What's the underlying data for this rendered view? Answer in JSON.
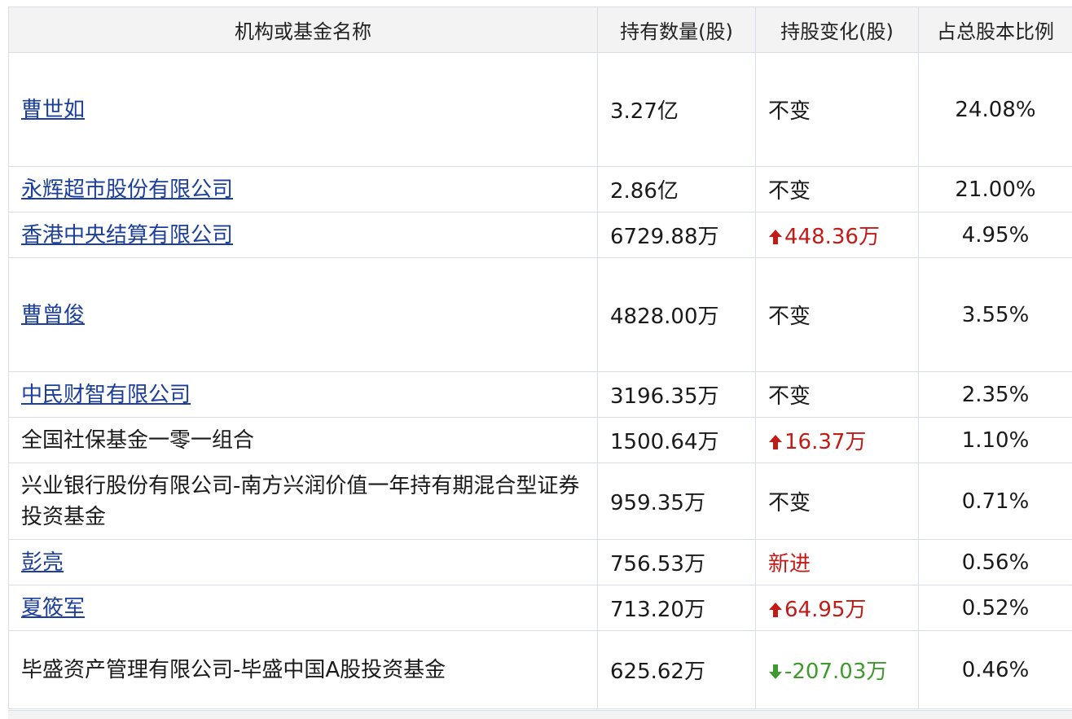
{
  "table": {
    "headers": [
      "机构或基金名称",
      "持有数量(股)",
      "持股变化(股)",
      "占总股本比例"
    ],
    "rows": [
      {
        "name": "曹世如",
        "link": true,
        "qty": "3.27亿",
        "change": "不变",
        "dir": "same",
        "pct": "24.08%"
      },
      {
        "name": "永辉超市股份有限公司",
        "link": true,
        "qty": "2.86亿",
        "change": "不变",
        "dir": "same",
        "pct": "21.00%"
      },
      {
        "name": "香港中央结算有限公司",
        "link": true,
        "qty": "6729.88万",
        "change": "448.36万",
        "dir": "up",
        "pct": "4.95%"
      },
      {
        "name": "曹曾俊",
        "link": true,
        "qty": "4828.00万",
        "change": "不变",
        "dir": "same",
        "pct": "3.55%"
      },
      {
        "name": "中民财智有限公司",
        "link": true,
        "qty": "3196.35万",
        "change": "不变",
        "dir": "same",
        "pct": "2.35%"
      },
      {
        "name": "全国社保基金一零一组合",
        "link": false,
        "qty": "1500.64万",
        "change": "16.37万",
        "dir": "up",
        "pct": "1.10%"
      },
      {
        "name": "兴业银行股份有限公司-南方兴润价值一年持有期混合型证券投资基金",
        "link": false,
        "qty": "959.35万",
        "change": "不变",
        "dir": "same",
        "pct": "0.71%"
      },
      {
        "name": "彭亮",
        "link": true,
        "qty": "756.53万",
        "change": "新进",
        "dir": "new",
        "pct": "0.56%"
      },
      {
        "name": "夏筱军",
        "link": true,
        "qty": "713.20万",
        "change": "64.95万",
        "dir": "up",
        "pct": "0.52%"
      },
      {
        "name": "毕盛资产管理有限公司-毕盛中国A股投资基金",
        "link": false,
        "qty": "625.62万",
        "change": "-207.03万",
        "dir": "down",
        "pct": "0.46%"
      }
    ]
  },
  "colors": {
    "up": "#c21b17",
    "down": "#3d9a2c",
    "link": "#1b3f9a"
  }
}
